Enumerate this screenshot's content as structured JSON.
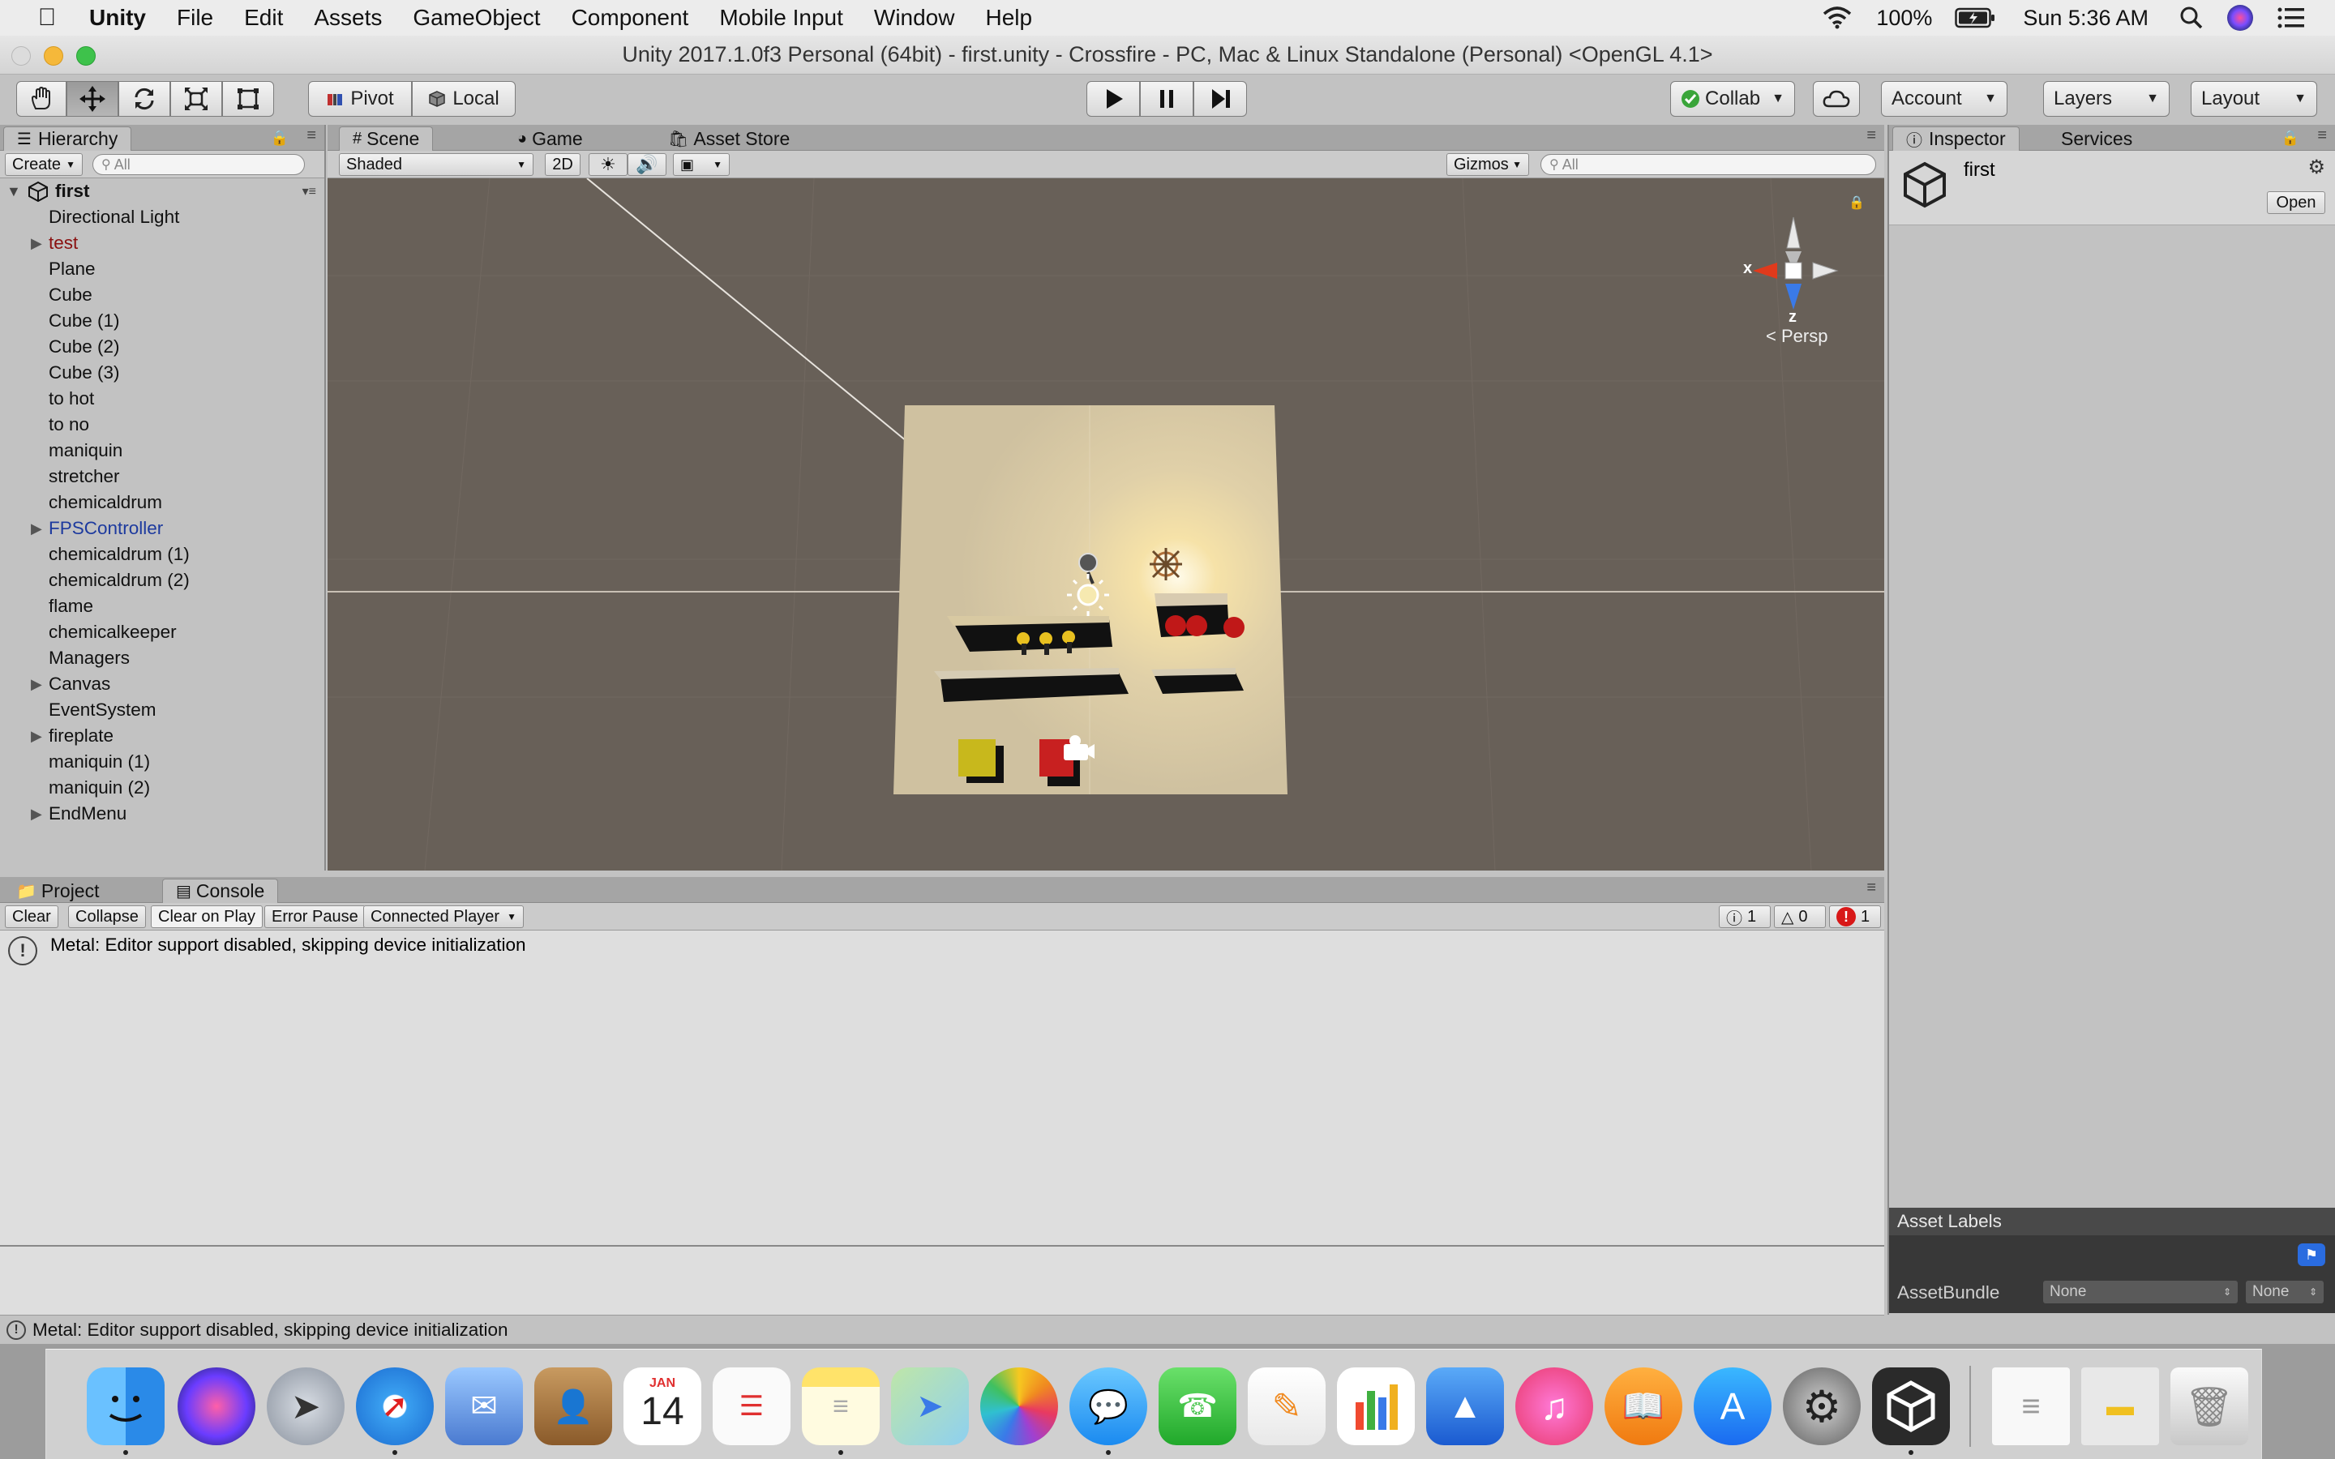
{
  "menubar": {
    "app_name": "Unity",
    "items": [
      "File",
      "Edit",
      "Assets",
      "GameObject",
      "Component",
      "Mobile Input",
      "Window",
      "Help"
    ],
    "battery": "100%",
    "clock": "Sun 5:36 AM"
  },
  "window": {
    "title": "Unity 2017.1.0f3 Personal (64bit) - first.unity - Crossfire - PC, Mac & Linux Standalone (Personal) <OpenGL 4.1>"
  },
  "toolbar": {
    "pivot_label": "Pivot",
    "local_label": "Local",
    "collab_label": "Collab",
    "account_label": "Account",
    "layers_label": "Layers",
    "layout_label": "Layout"
  },
  "hierarchy": {
    "tab_label": "Hierarchy",
    "create_label": "Create",
    "search_placeholder": "All",
    "scene_name": "first",
    "items": [
      {
        "label": "Directional Light",
        "expandable": false,
        "color": "normal"
      },
      {
        "label": "test",
        "expandable": true,
        "color": "red"
      },
      {
        "label": "Plane",
        "expandable": false,
        "color": "normal"
      },
      {
        "label": "Cube",
        "expandable": false,
        "color": "normal"
      },
      {
        "label": "Cube (1)",
        "expandable": false,
        "color": "normal"
      },
      {
        "label": "Cube (2)",
        "expandable": false,
        "color": "normal"
      },
      {
        "label": "Cube (3)",
        "expandable": false,
        "color": "normal"
      },
      {
        "label": "to hot",
        "expandable": false,
        "color": "normal"
      },
      {
        "label": "to no",
        "expandable": false,
        "color": "normal"
      },
      {
        "label": "maniquin",
        "expandable": false,
        "color": "normal"
      },
      {
        "label": "stretcher",
        "expandable": false,
        "color": "normal"
      },
      {
        "label": "chemicaldrum",
        "expandable": false,
        "color": "normal"
      },
      {
        "label": "FPSController",
        "expandable": true,
        "color": "blue"
      },
      {
        "label": "chemicaldrum (1)",
        "expandable": false,
        "color": "normal"
      },
      {
        "label": "chemicaldrum (2)",
        "expandable": false,
        "color": "normal"
      },
      {
        "label": "flame",
        "expandable": false,
        "color": "normal"
      },
      {
        "label": "chemicalkeeper",
        "expandable": false,
        "color": "normal"
      },
      {
        "label": "Managers",
        "expandable": false,
        "color": "normal"
      },
      {
        "label": "Canvas",
        "expandable": true,
        "color": "normal"
      },
      {
        "label": "EventSystem",
        "expandable": false,
        "color": "normal"
      },
      {
        "label": "fireplate",
        "expandable": true,
        "color": "normal"
      },
      {
        "label": "maniquin (1)",
        "expandable": false,
        "color": "normal"
      },
      {
        "label": "maniquin (2)",
        "expandable": false,
        "color": "normal"
      },
      {
        "label": "EndMenu",
        "expandable": true,
        "color": "normal"
      }
    ]
  },
  "scene": {
    "tabs": [
      "Scene",
      "Game",
      "Asset Store"
    ],
    "shading_mode": "Shaded",
    "mode_2d": "2D",
    "gizmos_label": "Gizmos",
    "search_placeholder": "All",
    "persp_label": "Persp",
    "axis_x": "x",
    "axis_z": "z"
  },
  "bottom": {
    "tabs": [
      "Project",
      "Console"
    ],
    "buttons": [
      "Clear",
      "Collapse",
      "Clear on Play",
      "Error Pause",
      "Connected Player"
    ],
    "counts": {
      "info": "1",
      "warning": "0",
      "error": "1"
    },
    "log_message": "Metal: Editor support disabled, skipping device initialization"
  },
  "inspector": {
    "tabs": [
      "Inspector",
      "Services"
    ],
    "object_name": "first",
    "open_label": "Open",
    "asset_labels_title": "Asset Labels",
    "assetbundle_label": "AssetBundle",
    "assetbundle_value": "None",
    "variant_value": "None"
  },
  "statusbar": {
    "message": "Metal: Editor support disabled, skipping device initialization"
  },
  "dock": {
    "calendar_month": "JAN",
    "calendar_day": "14"
  }
}
